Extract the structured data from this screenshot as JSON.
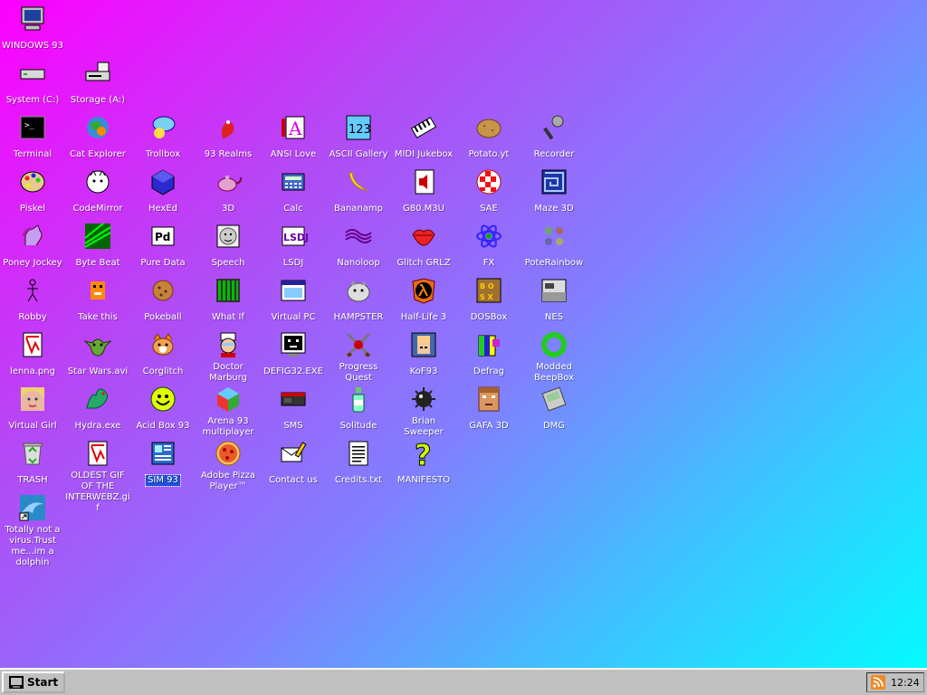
{
  "desktop": {
    "icons": [
      {
        "label": "WINDOWS 93",
        "icon": "computer-icon",
        "col": 0,
        "row": 0,
        "small": true
      },
      {
        "label": "System (C:)",
        "icon": "hard-drive-icon",
        "col": 0,
        "row": 1
      },
      {
        "label": "Storage (A:)",
        "icon": "floppy-drive-icon",
        "col": 1,
        "row": 1
      },
      {
        "label": "Terminal",
        "icon": "terminal-icon",
        "col": 0,
        "row": 2
      },
      {
        "label": "Cat Explorer",
        "icon": "globe-cat-icon",
        "col": 1,
        "row": 2
      },
      {
        "label": "Trollbox",
        "icon": "chat-bubble-icon",
        "col": 2,
        "row": 2
      },
      {
        "label": "93 Realms",
        "icon": "dragon-icon",
        "col": 3,
        "row": 2
      },
      {
        "label": "ANSI Love",
        "icon": "pencil-letter-icon",
        "col": 4,
        "row": 2
      },
      {
        "label": "ASCII Gallery",
        "icon": "numbers-icon",
        "col": 5,
        "row": 2
      },
      {
        "label": "MIDI Jukebox",
        "icon": "piano-keys-icon",
        "col": 6,
        "row": 2
      },
      {
        "label": "Potato.yt",
        "icon": "potato-icon",
        "col": 7,
        "row": 2
      },
      {
        "label": "Recorder",
        "icon": "microphone-icon",
        "col": 8,
        "row": 2
      },
      {
        "label": "Piskel",
        "icon": "paint-palette-icon",
        "col": 0,
        "row": 3
      },
      {
        "label": "CodeMirror",
        "icon": "cat-face-icon",
        "col": 1,
        "row": 3
      },
      {
        "label": "HexEd",
        "icon": "blue-cube-icon",
        "col": 2,
        "row": 3
      },
      {
        "label": "3D",
        "icon": "teapot-icon",
        "col": 3,
        "row": 3
      },
      {
        "label": "Calc",
        "icon": "calculator-icon",
        "col": 4,
        "row": 3
      },
      {
        "label": "Bananamp",
        "icon": "banana-icon",
        "col": 5,
        "row": 3
      },
      {
        "label": "G80.M3U",
        "icon": "speaker-document-icon",
        "col": 6,
        "row": 3
      },
      {
        "label": "SAE",
        "icon": "checkered-ball-icon",
        "col": 7,
        "row": 3
      },
      {
        "label": "Maze 3D",
        "icon": "maze-icon",
        "col": 8,
        "row": 3
      },
      {
        "label": "Poney Jockey",
        "icon": "pony-icon",
        "col": 0,
        "row": 4
      },
      {
        "label": "Byte Beat",
        "icon": "waveform-icon",
        "col": 1,
        "row": 4
      },
      {
        "label": "Pure Data",
        "icon": "pd-icon",
        "col": 2,
        "row": 4
      },
      {
        "label": "Speech",
        "icon": "face-icon",
        "col": 3,
        "row": 4
      },
      {
        "label": "LSDJ",
        "icon": "lsdj-icon",
        "col": 4,
        "row": 4
      },
      {
        "label": "Nanoloop",
        "icon": "wave-lines-icon",
        "col": 5,
        "row": 4
      },
      {
        "label": "Glitch GRLZ",
        "icon": "lips-icon",
        "col": 6,
        "row": 4
      },
      {
        "label": "FX",
        "icon": "atom-icon",
        "col": 7,
        "row": 4
      },
      {
        "label": "PoteRainbow",
        "icon": "people-group-icon",
        "col": 8,
        "row": 4
      },
      {
        "label": "Robby",
        "icon": "stick-figure-icon",
        "col": 0,
        "row": 5
      },
      {
        "label": "Take this",
        "icon": "pixel-character-icon",
        "col": 1,
        "row": 5
      },
      {
        "label": "Pokeball",
        "icon": "cookie-icon",
        "col": 2,
        "row": 5
      },
      {
        "label": "What If",
        "icon": "green-bars-icon",
        "col": 3,
        "row": 5
      },
      {
        "label": "Virtual PC",
        "icon": "window-icon",
        "col": 4,
        "row": 5
      },
      {
        "label": "HAMPSTER",
        "icon": "hamster-icon",
        "col": 5,
        "row": 5
      },
      {
        "label": "Half-Life 3",
        "icon": "lambda-icon",
        "col": 6,
        "row": 5
      },
      {
        "label": "DOSBox",
        "icon": "dosbox-icon",
        "col": 7,
        "row": 5
      },
      {
        "label": "NES",
        "icon": "nes-console-icon",
        "col": 8,
        "row": 5
      },
      {
        "label": "lenna.png",
        "icon": "image-file-icon",
        "col": 0,
        "row": 6
      },
      {
        "label": "Star Wars.avi",
        "icon": "yoda-icon",
        "col": 1,
        "row": 6
      },
      {
        "label": "Corglitch",
        "icon": "corgi-icon",
        "col": 2,
        "row": 6
      },
      {
        "label": "Doctor Marburg",
        "icon": "doctor-icon",
        "col": 3,
        "row": 6
      },
      {
        "label": "DEFIG32.EXE",
        "icon": "monitor-face-icon",
        "col": 4,
        "row": 6
      },
      {
        "label": "Progress Quest",
        "icon": "crossed-swords-icon",
        "col": 5,
        "row": 6
      },
      {
        "label": "KoF93",
        "icon": "fighter-icon",
        "col": 6,
        "row": 6
      },
      {
        "label": "Defrag",
        "icon": "defrag-icon",
        "col": 7,
        "row": 6
      },
      {
        "label": "Modded BeepBox",
        "icon": "green-ring-icon",
        "col": 8,
        "row": 6
      },
      {
        "label": "Virtual Girl",
        "icon": "girl-face-icon",
        "col": 0,
        "row": 7
      },
      {
        "label": "Hydra.exe",
        "icon": "hydra-icon",
        "col": 1,
        "row": 7
      },
      {
        "label": "Acid Box 93",
        "icon": "smiley-icon",
        "col": 2,
        "row": 7
      },
      {
        "label": "Arena 93 multiplayer",
        "icon": "color-cube-icon",
        "col": 3,
        "row": 7
      },
      {
        "label": "SMS",
        "icon": "sms-console-icon",
        "col": 4,
        "row": 7
      },
      {
        "label": "Solitude",
        "icon": "bottle-icon",
        "col": 5,
        "row": 7
      },
      {
        "label": "Brian Sweeper",
        "icon": "mine-icon",
        "col": 6,
        "row": 7
      },
      {
        "label": "GAFA 3D",
        "icon": "doom-face-icon",
        "col": 7,
        "row": 7
      },
      {
        "label": "DMG",
        "icon": "gameboy-icon",
        "col": 8,
        "row": 7
      },
      {
        "label": "TRASH",
        "icon": "recycle-bin-icon",
        "col": 0,
        "row": 8
      },
      {
        "label": "OLDEST GIF OF THE INTERWEBZ.gif",
        "icon": "image-file-icon",
        "col": 1,
        "row": 8
      },
      {
        "label": "SIM 93",
        "icon": "book-icon",
        "col": 2,
        "row": 8,
        "selected": true
      },
      {
        "label": "Adobe Pizza Player™",
        "icon": "pizza-icon",
        "col": 3,
        "row": 8
      },
      {
        "label": "Contact us",
        "icon": "envelope-pencil-icon",
        "col": 4,
        "row": 8
      },
      {
        "label": "Credits.txt",
        "icon": "text-file-icon",
        "col": 5,
        "row": 8
      },
      {
        "label": "MANIFESTO",
        "icon": "question-mark-icon",
        "col": 6,
        "row": 8
      },
      {
        "label": "Totally not a virus.Trust me...im a dolphin",
        "icon": "dolphin-shortcut-icon",
        "col": 0,
        "row": 9
      }
    ]
  },
  "taskbar": {
    "start_label": "Start",
    "clock": "12:24",
    "tray_icon": "rss-feed-icon"
  },
  "colors": {
    "selection": "#1e50d8",
    "taskbar": "#c0c0c0"
  }
}
